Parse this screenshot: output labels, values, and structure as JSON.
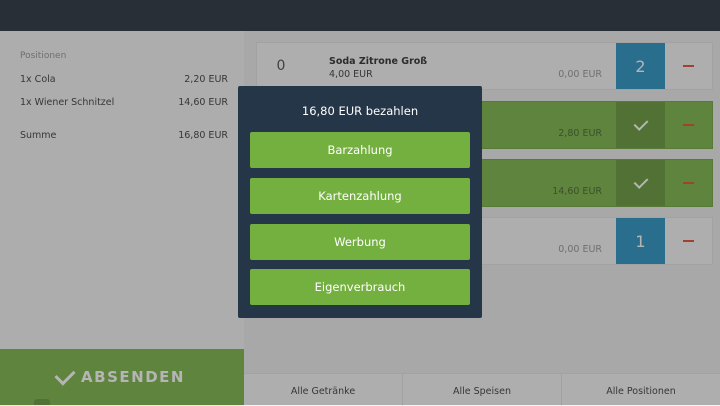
{
  "colors": {
    "accent_green": "#74b03f",
    "dark_green": "#5f9131",
    "blue": "#1f8dbe",
    "minus_red": "#e0452b",
    "modal_bg": "#253648",
    "topbar_bg": "#1e2834"
  },
  "summary": {
    "header": "Positionen",
    "items": [
      {
        "label": "1x Cola",
        "amount": "2,20 EUR"
      },
      {
        "label": "1x Wiener Schnitzel",
        "amount": "14,60 EUR"
      }
    ],
    "total_label": "Summe",
    "total_amount": "16,80 EUR",
    "submit_label": "ABSENDEN",
    "submit_icon": "check-icon"
  },
  "products": [
    {
      "count": "0",
      "name": "Soda Zitrone Groß",
      "price": "4,00 EUR",
      "total": "0,00 EUR",
      "qty": "2",
      "qty_style": "blue"
    },
    {
      "count": "",
      "name": "",
      "price": "",
      "total": "2,80 EUR",
      "qty": "",
      "qty_style": "check"
    },
    {
      "count": "",
      "name": "",
      "price": "",
      "total": "14,60 EUR",
      "qty": "",
      "qty_style": "check"
    },
    {
      "count": "",
      "name": "",
      "price": "",
      "total": "0,00 EUR",
      "qty": "1",
      "qty_style": "blue"
    }
  ],
  "tabs": [
    "Alle Getränke",
    "Alle Speisen",
    "Alle Positionen"
  ],
  "payment_dialog": {
    "title": "16,80 EUR bezahlen",
    "options": [
      "Barzahlung",
      "Kartenzahlung",
      "Werbung",
      "Eigenverbrauch"
    ]
  }
}
